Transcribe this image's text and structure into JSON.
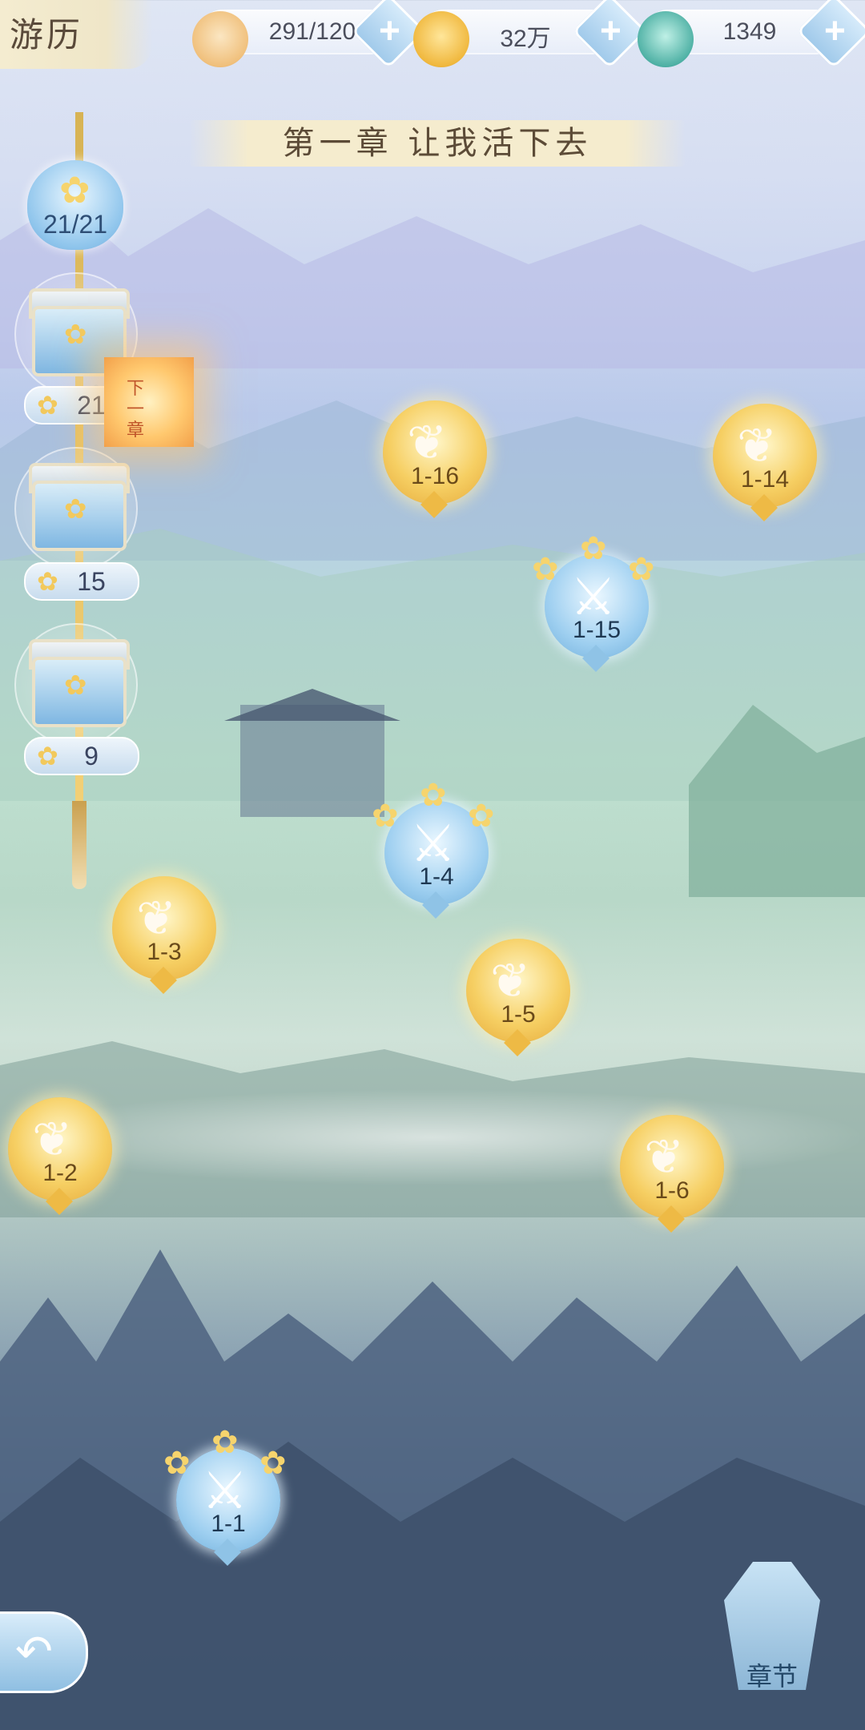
{
  "header": {
    "title": "游历",
    "resources": [
      {
        "icon": "cat-stamina-icon",
        "value": "291/120"
      },
      {
        "icon": "gold-coin-icon",
        "value": "32万"
      },
      {
        "icon": "jade-dragon-icon",
        "value": "1349"
      }
    ],
    "plus_label": "+"
  },
  "chapter": {
    "title": "第一章 让我活下去"
  },
  "progress": {
    "stars_total": "21/21",
    "rewards": [
      {
        "threshold": "21"
      },
      {
        "threshold": "15"
      },
      {
        "threshold": "9"
      }
    ]
  },
  "lantern": {
    "text": "下一章"
  },
  "stages": [
    {
      "id": "1-16",
      "type": "story"
    },
    {
      "id": "1-14",
      "type": "story"
    },
    {
      "id": "1-15",
      "type": "battle"
    },
    {
      "id": "1-4",
      "type": "battle"
    },
    {
      "id": "1-3",
      "type": "story"
    },
    {
      "id": "1-5",
      "type": "story"
    },
    {
      "id": "1-2",
      "type": "story"
    },
    {
      "id": "1-6",
      "type": "story"
    },
    {
      "id": "1-1",
      "type": "battle"
    }
  ],
  "footer": {
    "back_icon": "back-arrow-icon",
    "chapter_label": "章节"
  }
}
